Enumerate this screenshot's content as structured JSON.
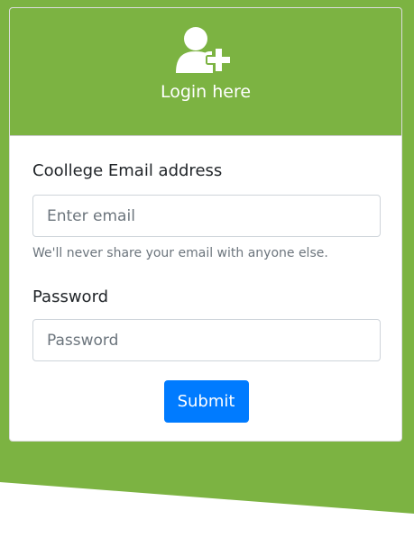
{
  "header": {
    "icon": "user-plus-icon",
    "title": "Login here"
  },
  "form": {
    "email_label": "Coollege Email address",
    "email_placeholder": "Enter email",
    "email_value": "",
    "email_help": "We'll never share your email with anyone else.",
    "password_label": "Password",
    "password_placeholder": "Password",
    "password_value": "",
    "submit_label": "Submit"
  },
  "colors": {
    "header_green": "#7cb342",
    "submit_blue": "#007bff",
    "background_white": "#ffffff"
  }
}
